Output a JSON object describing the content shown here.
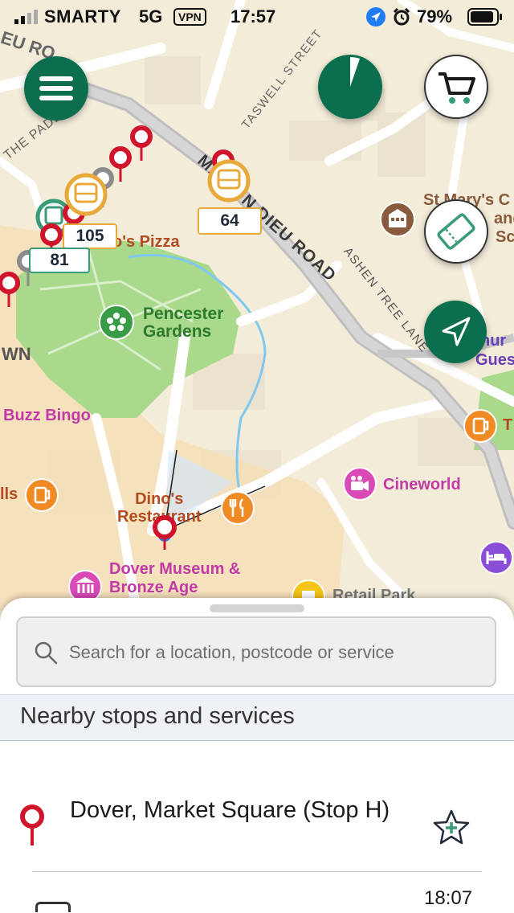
{
  "status_bar": {
    "carrier": "SMARTY",
    "network": "5G",
    "vpn": "VPN",
    "time": "17:57",
    "battery": "79%"
  },
  "map": {
    "street_labels": [
      "THE PADD",
      "TASWELL STREET",
      "MAISON DIEU ROAD",
      "ASHEN TREE LANE",
      "EU RO"
    ],
    "poi_labels": {
      "pizza": "o's Pizza",
      "gardens_line1": "Pencester",
      "gardens_line2": "Gardens",
      "bingo": "Buzz Bingo",
      "cineworld": "Cineworld",
      "dinos_line1": "Dino's",
      "dinos_line2": "Restaurant",
      "museum_line1": "Dover Museum &",
      "museum_line2": "Bronze Age",
      "stmarys_line1": "St Mary's C",
      "stmarys_line2": "and",
      "stmarys_line3": "Sc",
      "church_line1": "hur",
      "church_line2": "Gues",
      "retail": "Retail Park",
      "wn": "WN",
      "lls": "lls",
      "t": "T"
    },
    "bus_labels": [
      "105",
      "81",
      "64"
    ]
  },
  "controls": {
    "menu_icon": "hamburger-menu-icon",
    "timer_icon": "refresh-timer-icon",
    "cart_icon": "shopping-cart-icon",
    "ticket_icon": "ticket-icon",
    "locate_icon": "location-arrow-icon"
  },
  "sheet": {
    "search_placeholder": "Search for a location, postcode or service",
    "section_title": "Nearby stops and services",
    "stop_name": "Dover, Market Square (Stop H)",
    "next_time": "18:07"
  },
  "colors": {
    "brand_green": "#0b6e4f",
    "pin_red": "#d0142c",
    "bus_orange": "#e8a93a"
  }
}
